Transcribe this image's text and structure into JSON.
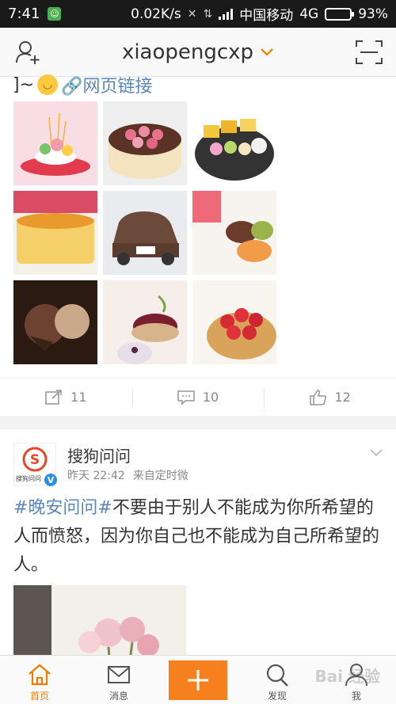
{
  "status_bar": {
    "time": "7:41",
    "speed": "0.02K/s",
    "carrier": "中国移动",
    "network": "4G",
    "battery": "93%",
    "battery_level": 0.93
  },
  "header": {
    "title": "xiaopengcxp",
    "left_icon": "add-friend-icon",
    "right_icon": "scan-icon"
  },
  "post1": {
    "text_prefix": "]~",
    "link_label": "网页链接",
    "images": [
      "cake-dessert-1",
      "rose-cake",
      "fruit-platter",
      "cheesecake",
      "car-cake",
      "macarons",
      "chocolate-ice-cream",
      "berry-tarts",
      "strawberry-tart"
    ],
    "repost_count": "11",
    "comment_count": "10",
    "like_count": "12"
  },
  "post2": {
    "user_name": "搜狗问问",
    "avatar_caption": "搜狗问问",
    "time": "昨天 22:42",
    "source": "来自定时微",
    "hashtag": "#晚安问问#",
    "body": "不要由于别人不能成为你所希望的人而愤怒，因为你自己也不能成为自己所希望的人。"
  },
  "tabs": {
    "home": "首页",
    "messages": "消息",
    "discover": "发现",
    "me": "我"
  },
  "watermark": "Bai 经验",
  "colors": {
    "accent": "#f07d00",
    "link": "#5b86b8",
    "compose": "#f7801e"
  }
}
